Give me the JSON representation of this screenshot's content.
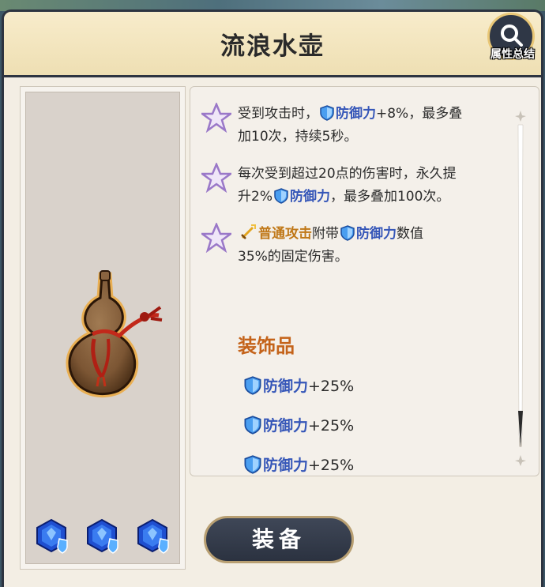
{
  "window": {
    "title": "流浪水壶"
  },
  "search_button": {
    "label": "属性总结",
    "icon": "magnifier-icon"
  },
  "item": {
    "name": "流浪水壶",
    "icon": "gourd-item-icon",
    "gems": [
      "blue-gem-icon",
      "blue-gem-icon",
      "blue-gem-icon"
    ]
  },
  "effects": [
    {
      "line1_a": "受到攻击时，",
      "line1_kw": "防御力",
      "line1_b": "+8%，最多叠",
      "line2": "加10次，持续5秒。"
    },
    {
      "line1": "每次受到超过20点的伤害时，永久提",
      "line2_a": "升2%",
      "line2_kw": "防御力",
      "line2_b": "，最多叠加100次。"
    },
    {
      "line1_kw1": "普通攻击",
      "line1_a": "附带",
      "line1_kw2": "防御力",
      "line1_b": "数值",
      "line2": "35%的固定伤害。"
    }
  ],
  "accessory": {
    "title": "装饰品",
    "stats": [
      {
        "name": "防御力",
        "value": "+25%"
      },
      {
        "name": "防御力",
        "value": "+25%"
      },
      {
        "name": "防御力",
        "value": "+25%"
      }
    ]
  },
  "equip_button": {
    "label": "装备"
  },
  "colors": {
    "keyword_blue": "#3556b8",
    "keyword_orange": "#c07818",
    "section_orange": "#c4631a",
    "dark": "#2d3440"
  }
}
